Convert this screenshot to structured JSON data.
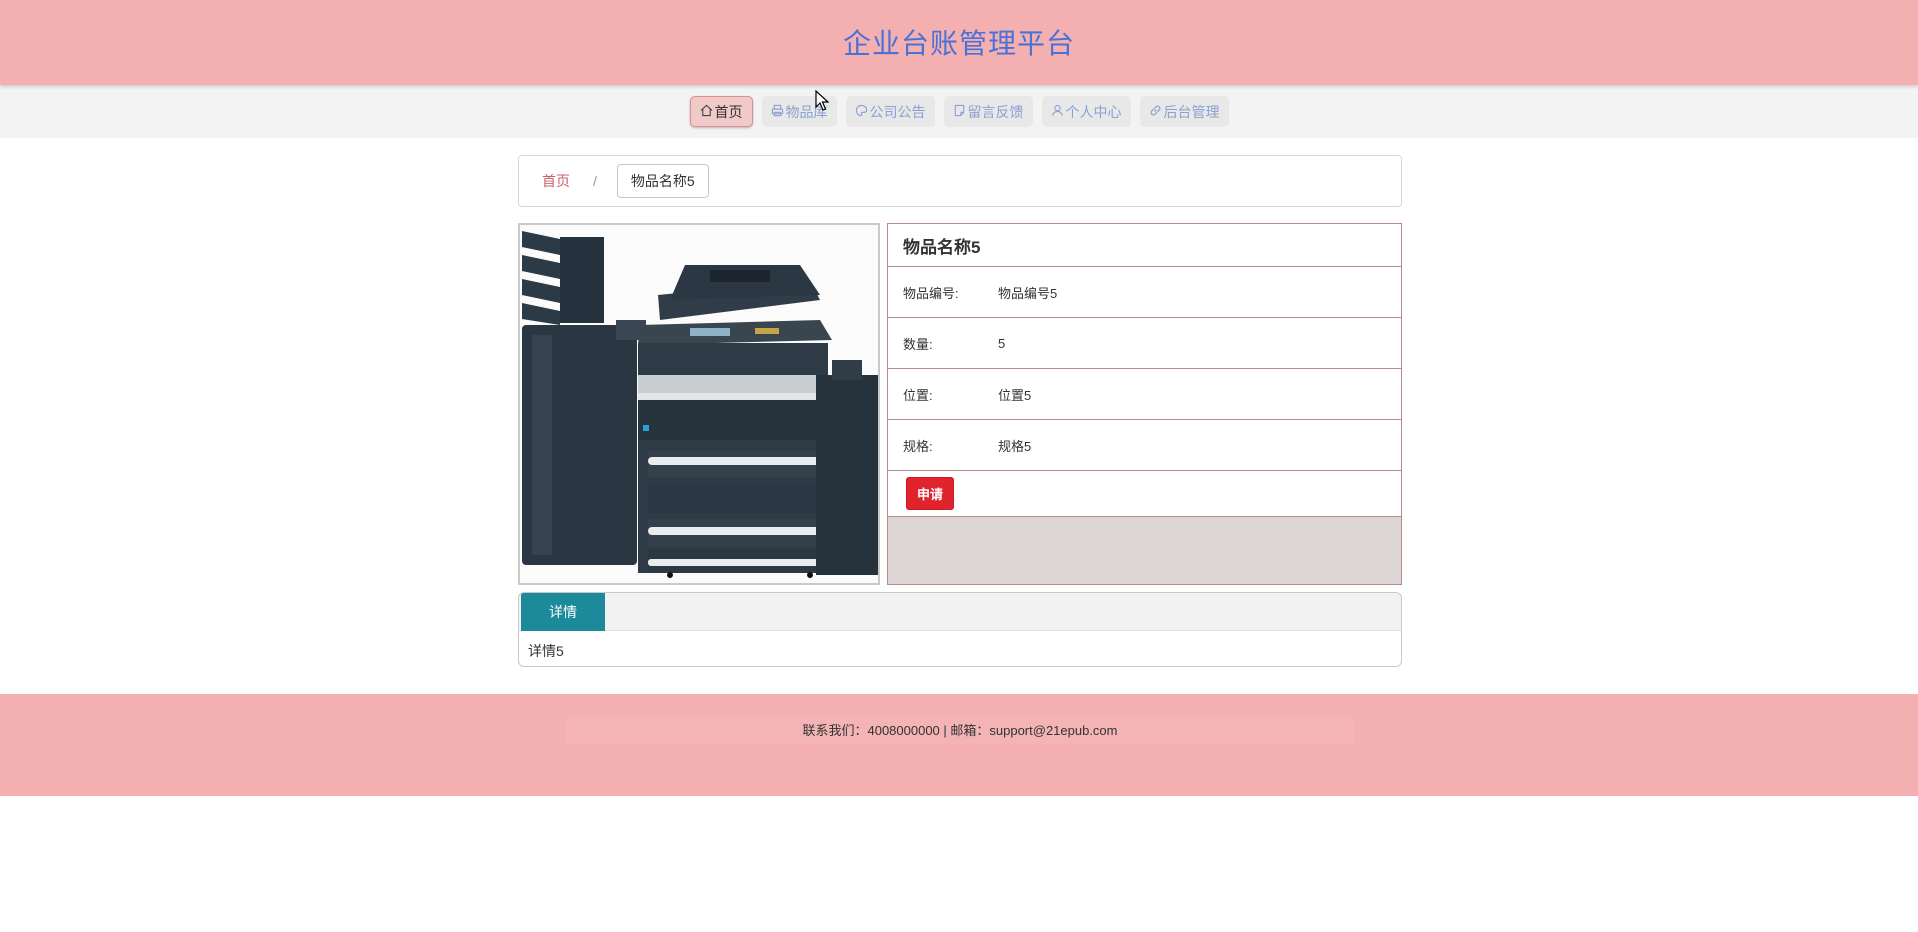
{
  "header": {
    "title": "企业台账管理平台"
  },
  "nav": {
    "items": [
      {
        "label": "首页",
        "icon": "home-icon",
        "active": true
      },
      {
        "label": "物品库",
        "icon": "printer-icon",
        "active": false
      },
      {
        "label": "公司公告",
        "icon": "palette-icon",
        "active": false
      },
      {
        "label": "留言反馈",
        "icon": "note-icon",
        "active": false
      },
      {
        "label": "个人中心",
        "icon": "user-icon",
        "active": false
      },
      {
        "label": "后台管理",
        "icon": "link-icon",
        "active": false
      }
    ]
  },
  "breadcrumb": {
    "home": "首页",
    "separator": "/",
    "current": "物品名称5"
  },
  "product": {
    "image_alt": "printer-image",
    "title": "物品名称5",
    "fields": [
      {
        "label": "物品编号:",
        "value": "物品编号5"
      },
      {
        "label": "数量:",
        "value": "5"
      },
      {
        "label": "位置:",
        "value": "位置5"
      },
      {
        "label": "规格:",
        "value": "规格5"
      }
    ],
    "apply_label": "申请"
  },
  "detail": {
    "tab_label": "详情",
    "content": "详情5"
  },
  "footer": {
    "text": "联系我们：4008000000 | 邮箱：support@21epub.com"
  },
  "colors": {
    "header_bg": "#f4afb0",
    "title": "#4a72d6",
    "apply_button": "#e0232c",
    "tab_active": "#1c8a9a"
  }
}
